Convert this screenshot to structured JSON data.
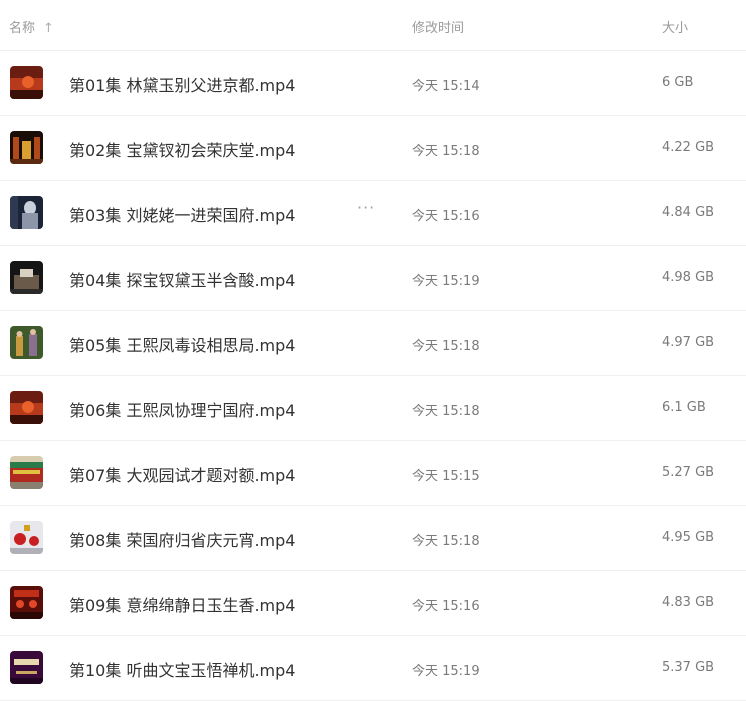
{
  "header": {
    "name_label": "名称",
    "sort_icon": "arrow-up-icon",
    "date_label": "修改时间",
    "size_label": "大小"
  },
  "files": [
    {
      "name": "第01集 林黛玉别父进京都.mp4",
      "date": "今天 15:14",
      "size": "6 GB",
      "thumb": "sunset"
    },
    {
      "name": "第02集 宝黛钗初会荣庆堂.mp4",
      "date": "今天 15:18",
      "size": "4.22 GB",
      "thumb": "hall"
    },
    {
      "name": "第03集 刘姥姥一进荣国府.mp4",
      "date": "今天 15:16",
      "size": "4.84 GB",
      "thumb": "figure"
    },
    {
      "name": "第04集 探宝钗黛玉半含酸.mp4",
      "date": "今天 15:19",
      "size": "4.98 GB",
      "thumb": "room"
    },
    {
      "name": "第05集 王熙凤毒设相思局.mp4",
      "date": "今天 15:18",
      "size": "4.97 GB",
      "thumb": "garden"
    },
    {
      "name": "第06集 王熙凤协理宁国府.mp4",
      "date": "今天 15:18",
      "size": "6.1 GB",
      "thumb": "sunset"
    },
    {
      "name": "第07集 大观园试才题对额.mp4",
      "date": "今天 15:15",
      "size": "5.27 GB",
      "thumb": "gate"
    },
    {
      "name": "第08集 荣国府归省庆元宵.mp4",
      "date": "今天 15:18",
      "size": "4.95 GB",
      "thumb": "lantern"
    },
    {
      "name": "第09集 意绵绵静日玉生香.mp4",
      "date": "今天 15:16",
      "size": "4.83 GB",
      "thumb": "red-hall"
    },
    {
      "name": "第10集 听曲文宝玉悟禅机.mp4",
      "date": "今天 15:19",
      "size": "5.37 GB",
      "thumb": "title-card"
    }
  ],
  "more_icon": "more-horizontal-icon",
  "thumb_colors": {
    "sunset_top": "#6b1d12",
    "sunset_bottom": "#e8602a",
    "dark": "#1a0d08"
  }
}
